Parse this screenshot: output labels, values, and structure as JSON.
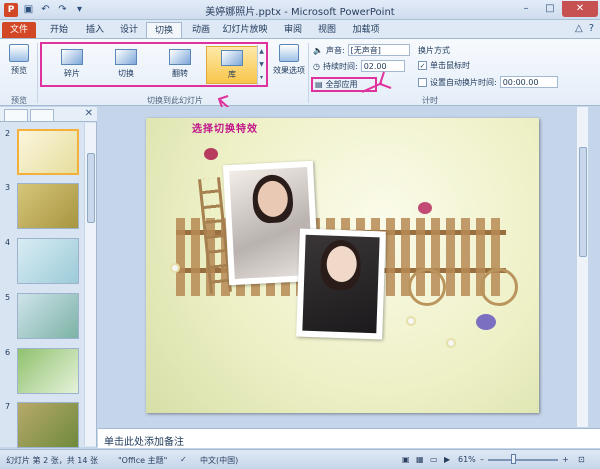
{
  "window": {
    "title": "美婷娜照片.pptx - Microsoft PowerPoint",
    "app_icon": "P"
  },
  "qat": {
    "icons": [
      "save-icon",
      "undo-icon",
      "redo-icon",
      "customize-icon"
    ]
  },
  "tabs": [
    {
      "label": "文件",
      "active": false
    },
    {
      "label": "开始",
      "active": false
    },
    {
      "label": "插入",
      "active": false
    },
    {
      "label": "设计",
      "active": false
    },
    {
      "label": "切换",
      "active": true
    },
    {
      "label": "动画",
      "active": false
    },
    {
      "label": "幻灯片放映",
      "active": false
    },
    {
      "label": "审阅",
      "active": false
    },
    {
      "label": "视图",
      "active": false
    },
    {
      "label": "加载项",
      "active": false
    }
  ],
  "ribbon": {
    "preview": {
      "label": "预览",
      "group": "预览"
    },
    "gallery": {
      "items": [
        {
          "label": "碎片",
          "selected": false
        },
        {
          "label": "切换",
          "selected": false
        },
        {
          "label": "翻转",
          "selected": false
        },
        {
          "label": "库",
          "selected": true
        }
      ],
      "group": "切换到此幻灯片"
    },
    "effect_options": {
      "label": "效果选项"
    },
    "timing": {
      "sound_label": "声音:",
      "sound_value": "[无声音]",
      "duration_label": "持续时间:",
      "duration_value": "02.00",
      "apply_all": "全部应用",
      "switch_mode": "换片方式",
      "on_click": "单击鼠标时",
      "on_click_checked": true,
      "auto_after": "设置自动换片时间:",
      "auto_after_checked": false,
      "auto_after_value": "00:00.00",
      "group": "计时"
    }
  },
  "annotation": "选择切换特效",
  "slides_panel": {
    "tab_labels": [
      "",
      "",
      ""
    ],
    "slides": [
      {
        "number": "2",
        "selected": true
      },
      {
        "number": "3",
        "selected": false
      },
      {
        "number": "4",
        "selected": false
      },
      {
        "number": "5",
        "selected": false
      },
      {
        "number": "6",
        "selected": false
      },
      {
        "number": "7",
        "selected": false
      }
    ]
  },
  "notes": {
    "placeholder": "单击此处添加备注"
  },
  "status": {
    "slide_info": "幻灯片 第 2 张，共 14 张",
    "theme": "\"Office 主题\"",
    "language": "中文(中国)",
    "zoom": "61%"
  }
}
